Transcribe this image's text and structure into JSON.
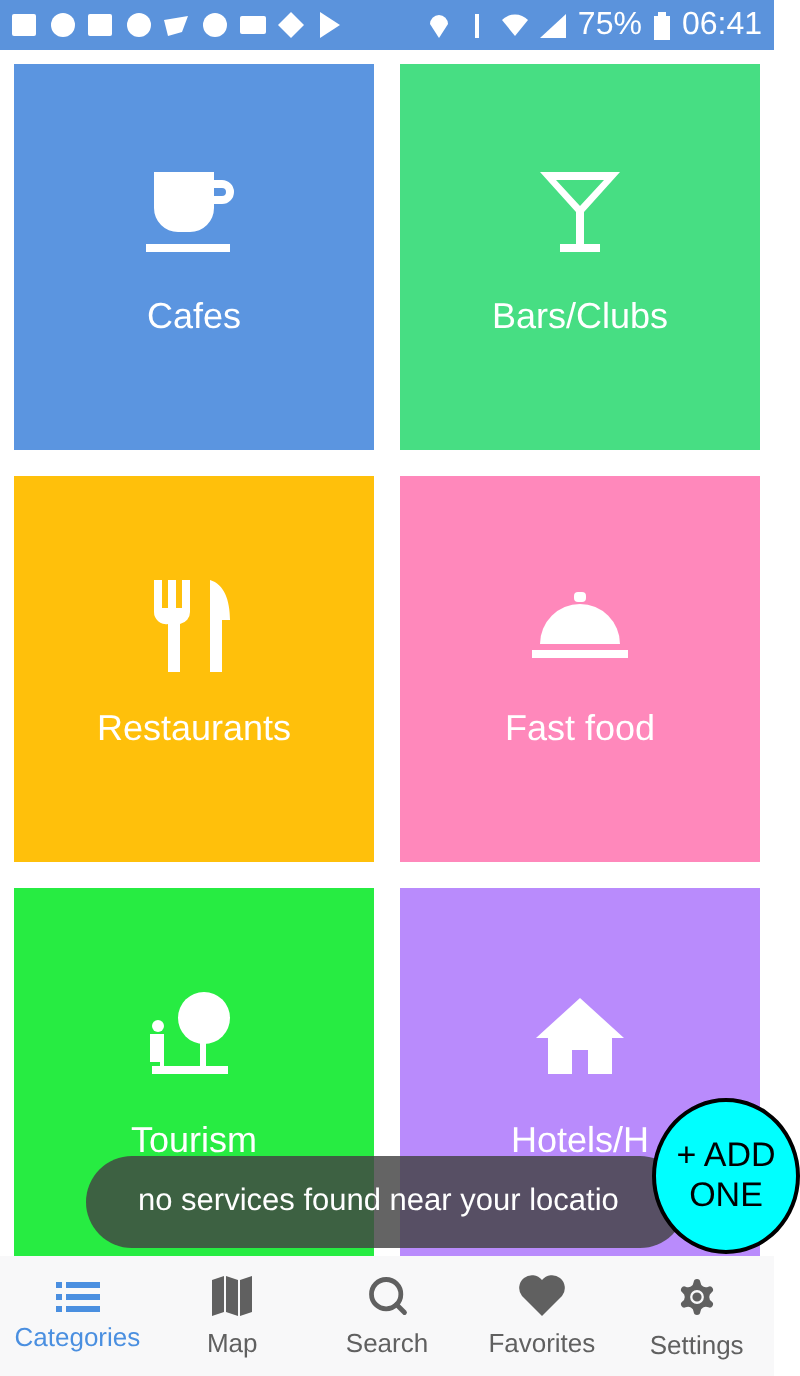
{
  "status_bar": {
    "battery": "75%",
    "time": "06:41"
  },
  "categories": [
    {
      "label": "Cafes",
      "color": "#5b95e0"
    },
    {
      "label": "Bars/Clubs",
      "color": "#47de83"
    },
    {
      "label": "Restaurants",
      "color": "#ffc00b"
    },
    {
      "label": "Fast food",
      "color": "#ff88bb"
    },
    {
      "label": "Tourism",
      "color": "#27ec42"
    },
    {
      "label": "Hotels/H",
      "color": "#b98bfc"
    }
  ],
  "toast": {
    "message": "no services found near your locatio"
  },
  "add_button": {
    "label": "+ ADD ONE"
  },
  "bottom_nav": [
    {
      "label": "Categories",
      "selected": true
    },
    {
      "label": "Map",
      "selected": false
    },
    {
      "label": "Search",
      "selected": false
    },
    {
      "label": "Favorites",
      "selected": false
    },
    {
      "label": "Settings",
      "selected": false
    }
  ]
}
